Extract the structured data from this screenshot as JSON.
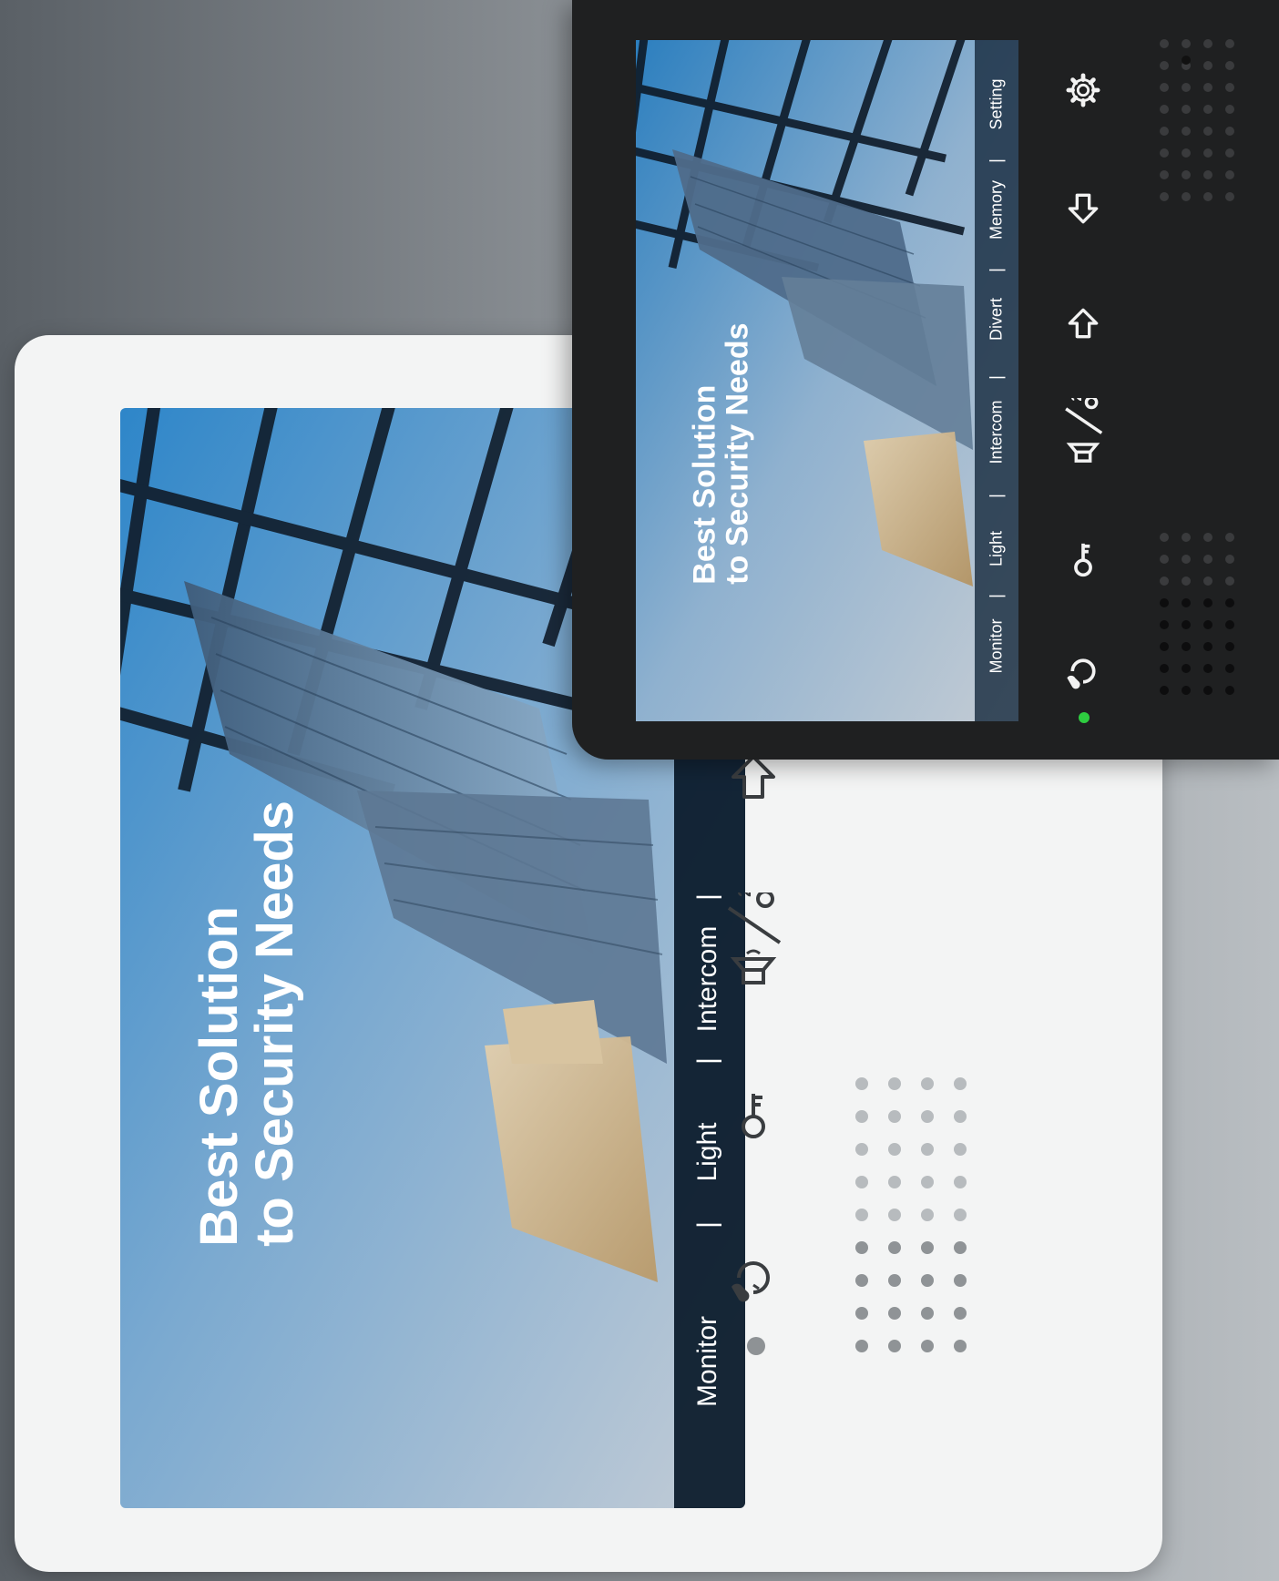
{
  "white_monitor": {
    "tagline": {
      "line1": "Best Solution",
      "line2": "to Security Needs"
    },
    "menu": [
      "Monitor",
      "Light",
      "Intercom"
    ],
    "icons": [
      "answer-icon",
      "unlock-key-icon",
      "volume-unlock2-icon",
      "left-arrow-icon"
    ],
    "status_led_color": "#8e9295"
  },
  "dark_monitor": {
    "tagline": {
      "line1": "Best Solution",
      "line2": "to Security Needs"
    },
    "menu": [
      "Monitor",
      "Light",
      "Intercom",
      "Divert",
      "Memory",
      "Setting"
    ],
    "icons": [
      "answer-icon",
      "unlock-key-icon",
      "volume-unlock2-icon",
      "left-arrow-icon",
      "right-arrow-icon",
      "gear-icon"
    ],
    "status_led_color": "#2ecc40"
  },
  "colors": {
    "menu_bar": "#0a1b2c",
    "sky_top": "#2f86c9",
    "sky_bottom": "#b9c8d6",
    "device_white": "#f3f4f4",
    "device_dark": "#1f2021"
  }
}
